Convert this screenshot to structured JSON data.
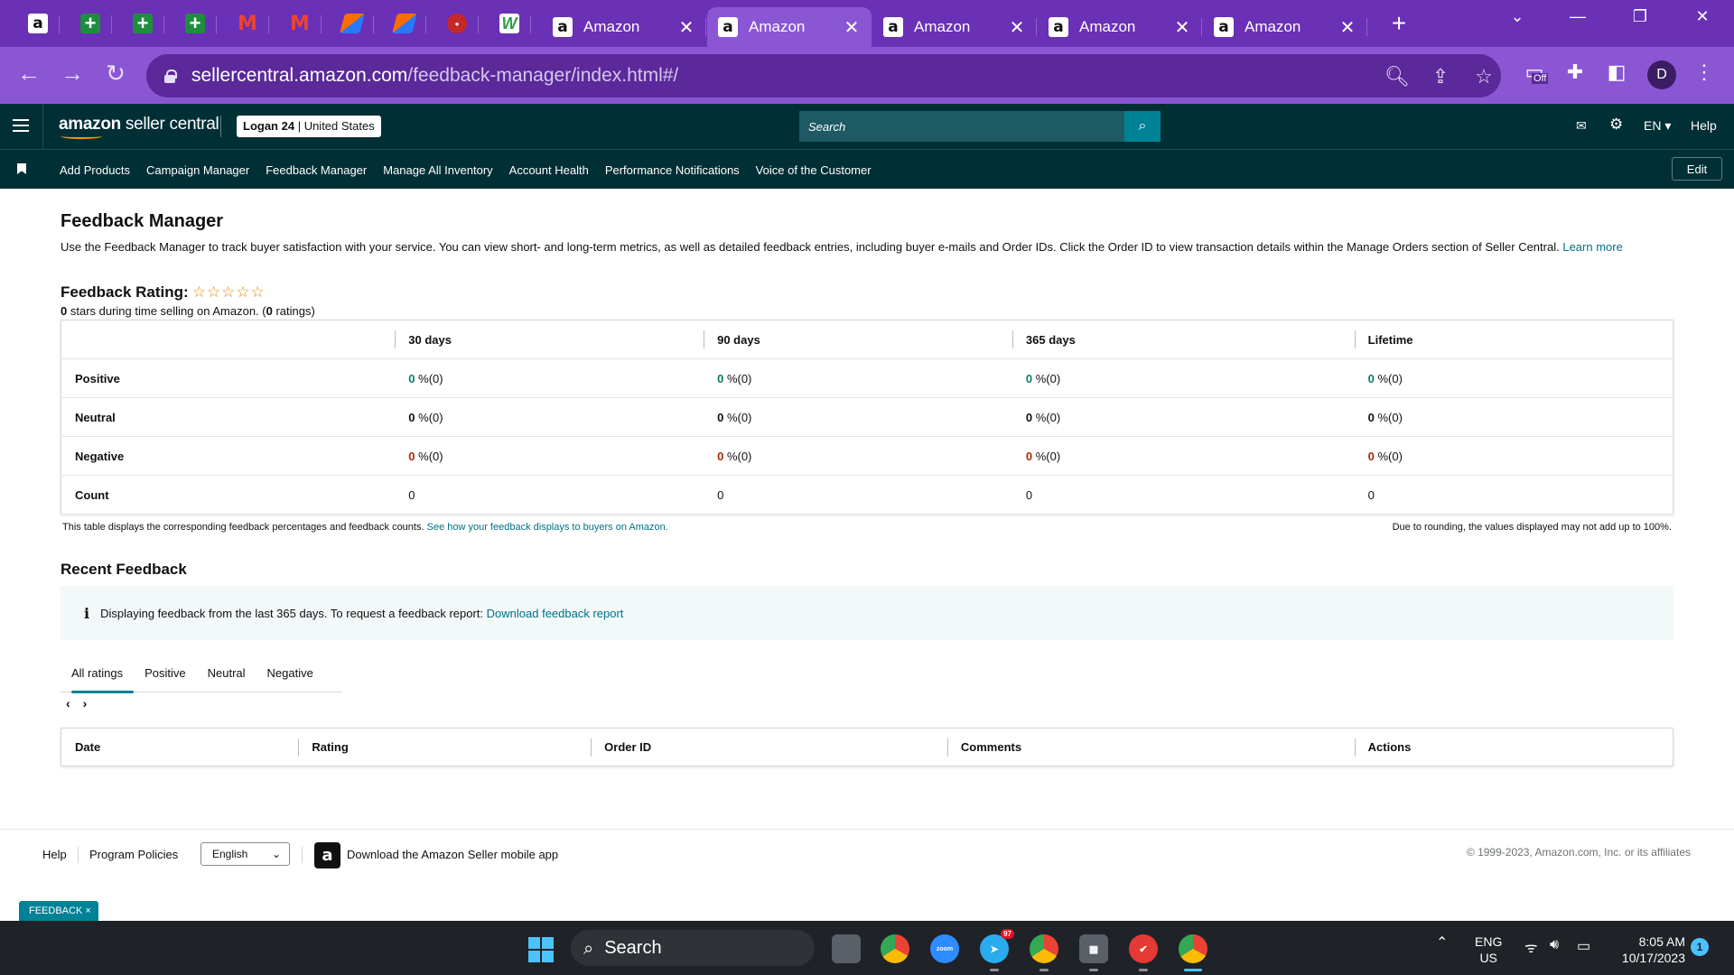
{
  "browser": {
    "tabs": [
      {
        "title": "Amazon",
        "active": false
      },
      {
        "title": "Amazon",
        "active": true
      },
      {
        "title": "Amazon",
        "active": false
      },
      {
        "title": "Amazon",
        "active": false
      },
      {
        "title": "Amazon",
        "active": false
      }
    ],
    "pinned_favicons": [
      "amazon-icon",
      "plus-icon",
      "plus-icon",
      "plus-icon",
      "gmail-icon",
      "gmail-icon",
      "orange-app-icon",
      "orange-app-icon",
      "red-app-icon",
      "w-app-icon"
    ],
    "url_domain": "sellercentral.amazon.com",
    "url_path": "/feedback-manager/index.html#/",
    "profile_initial": "D",
    "extension_badge": "Off",
    "accent_color": "#6a30b5"
  },
  "header": {
    "logo_main": "amazon",
    "logo_suffix": " seller central",
    "store_name": "Logan 24",
    "store_region": "United States",
    "search_placeholder": "Search",
    "language": "EN",
    "help": "Help"
  },
  "nav": {
    "links": [
      "Add Products",
      "Campaign Manager",
      "Feedback Manager",
      "Manage All Inventory",
      "Account Health",
      "Performance Notifications",
      "Voice of the Customer"
    ],
    "edit": "Edit"
  },
  "page": {
    "title": "Feedback Manager",
    "intro": "Use the Feedback Manager to track buyer satisfaction with your service. You can view short- and long-term metrics, as well as detailed feedback entries, including buyer e-mails and Order IDs. Click the Order ID to view transaction details within the Manage Orders section of Seller Central.",
    "learn_more": "Learn more",
    "rating_label": "Feedback Rating:",
    "stars": "☆☆☆☆☆",
    "rating_stars_value": "0",
    "rating_sub_middle": " stars during time selling on Amazon. (",
    "rating_count": "0",
    "rating_sub_end": " ratings)"
  },
  "feedback_table": {
    "columns": [
      "30 days",
      "90 days",
      "365 days",
      "Lifetime"
    ],
    "rows": [
      {
        "label": "Positive",
        "values": [
          "0",
          "0",
          "0",
          "0"
        ],
        "suffix": " %(0)",
        "tone": "positive"
      },
      {
        "label": "Neutral",
        "values": [
          "0",
          "0",
          "0",
          "0"
        ],
        "suffix": " %(0)",
        "tone": "neutral"
      },
      {
        "label": "Negative",
        "values": [
          "0",
          "0",
          "0",
          "0"
        ],
        "suffix": " %(0)",
        "tone": "negative"
      },
      {
        "label": "Count",
        "values": [
          "0",
          "0",
          "0",
          "0"
        ],
        "suffix": "",
        "tone": "count"
      }
    ],
    "note": "This table displays the corresponding feedback percentages and feedback counts.",
    "note_link": "See how your feedback displays to buyers on Amazon.",
    "note_right": "Due to rounding, the values displayed may not add up to 100%."
  },
  "recent": {
    "title": "Recent Feedback",
    "info_text": "Displaying feedback from the last 365 days. To request a feedback report:",
    "info_link": "Download feedback report",
    "tabs": [
      "All ratings",
      "Positive",
      "Neutral",
      "Negative"
    ],
    "active_tab": "All ratings",
    "columns": [
      "Date",
      "Rating",
      "Order ID",
      "Comments",
      "Actions"
    ]
  },
  "footer": {
    "help": "Help",
    "program_policies": "Program Policies",
    "language": "English",
    "app_text": "Download the Amazon Seller mobile app",
    "copyright": "© 1999-2023, Amazon.com, Inc. or its affiliates",
    "feedback_badge": "FEEDBACK"
  },
  "taskbar": {
    "search": "Search",
    "telegram_badge": "97",
    "lang": "ENG",
    "region": "US",
    "time": "8:05 AM",
    "date": "10/17/2023",
    "notifications": "1"
  }
}
